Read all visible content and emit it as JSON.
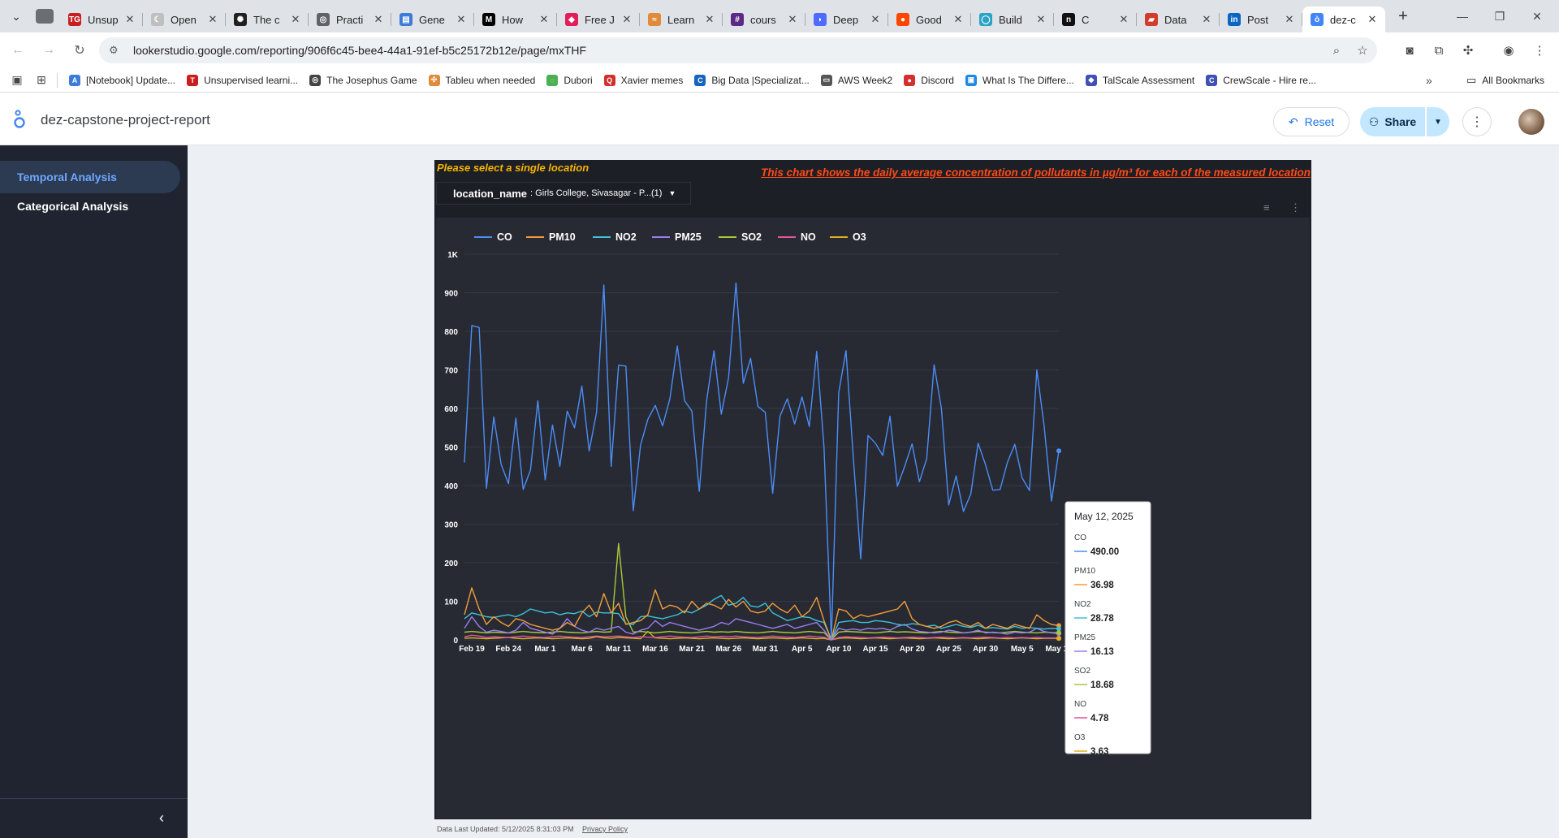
{
  "browser": {
    "tabs": [
      {
        "label": "Unsup",
        "icon": "tg-icon",
        "color": "#c81e1e",
        "glyph": "TG"
      },
      {
        "label": "Open",
        "icon": "crescent-icon",
        "color": "#bfbfbf",
        "glyph": "☾"
      },
      {
        "label": "The c",
        "icon": "aperture-icon",
        "color": "#202020",
        "glyph": "✺"
      },
      {
        "label": "Practi",
        "icon": "globe-icon",
        "color": "#5f6368",
        "glyph": "◎"
      },
      {
        "label": "Gene",
        "icon": "doc-icon",
        "color": "#3c7bd9",
        "glyph": "▤"
      },
      {
        "label": "How",
        "icon": "medium-icon",
        "color": "#000000",
        "glyph": "M"
      },
      {
        "label": "Free J",
        "icon": "cube-icon",
        "color": "#e11d5a",
        "glyph": "◆"
      },
      {
        "label": "Learn",
        "icon": "wave-icon",
        "color": "#e08a3c",
        "glyph": "≈"
      },
      {
        "label": "cours",
        "icon": "slack-icon",
        "color": "#5b2a86",
        "glyph": "#"
      },
      {
        "label": "Deep",
        "icon": "whale-icon",
        "color": "#4d6bfe",
        "glyph": "◗"
      },
      {
        "label": "Good",
        "icon": "reddit-icon",
        "color": "#ff4500",
        "glyph": "●"
      },
      {
        "label": "Build",
        "icon": "circle-icon",
        "color": "#29a3c7",
        "glyph": "◯"
      },
      {
        "label": "C",
        "icon": "notion-icon",
        "color": "#111111",
        "glyph": "n"
      },
      {
        "label": "Data",
        "icon": "paper-icon",
        "color": "#d43b2f",
        "glyph": "▰"
      },
      {
        "label": "Post",
        "icon": "linkedin-icon",
        "color": "#0a66c2",
        "glyph": "in"
      },
      {
        "label": "dez-c",
        "icon": "lookerstudio-icon",
        "color": "#4285f4",
        "glyph": "ò",
        "active": true
      }
    ],
    "url": "lookerstudio.google.com/reporting/906f6c45-bee4-44a1-91ef-b5c25172b12e/page/mxTHF",
    "bookmarks": [
      {
        "label": "[Notebook] Update...",
        "color": "#3c7bd9",
        "glyph": "A"
      },
      {
        "label": "Unsupervised learni...",
        "color": "#c81e1e",
        "glyph": "T"
      },
      {
        "label": "The Josephus Game",
        "color": "#444444",
        "glyph": "◎"
      },
      {
        "label": "Tableu when needed",
        "color": "#e08a3c",
        "glyph": "✣"
      },
      {
        "label": "Dubori",
        "color": "#4caf50",
        "glyph": "◌"
      },
      {
        "label": "Xavier memes",
        "color": "#d32f2f",
        "glyph": "Q"
      },
      {
        "label": "Big Data |Specializat...",
        "color": "#1565c0",
        "glyph": "C"
      },
      {
        "label": "AWS Week2",
        "color": "#555555",
        "glyph": "▭"
      },
      {
        "label": "Discord",
        "color": "#d32f2f",
        "glyph": "●"
      },
      {
        "label": "What Is The Differe...",
        "color": "#1e88e5",
        "glyph": "▣"
      },
      {
        "label": "TalScale Assessment",
        "color": "#3f51b5",
        "glyph": "◆"
      },
      {
        "label": "CrewScale - Hire re...",
        "color": "#3f51b5",
        "glyph": "C"
      }
    ],
    "all_bookmarks": "All Bookmarks",
    "more_bookmarks": "»"
  },
  "header": {
    "title": "dez-capstone-project-report",
    "reset_label": "Reset",
    "share_label": "Share"
  },
  "sidebar": {
    "items": [
      {
        "label": "Temporal Analysis",
        "active": true
      },
      {
        "label": "Categorical Analysis",
        "active": false
      }
    ]
  },
  "report": {
    "hint": "Please select a single location",
    "note": "This chart shows the daily average concentration of pollutants in µg/m³ for each of the measured location",
    "filter_name": "location_name",
    "filter_value": ": Girls College, Sivasagar - P...(1)",
    "footer_updated": "Data Last Updated: 5/12/2025 8:31:03 PM",
    "footer_privacy": "Privacy Policy"
  },
  "chart_data": {
    "type": "line",
    "x_start": "2025-02-18",
    "x_end": "2025-05-12",
    "x_ticks": [
      "Feb 19",
      "Feb 24",
      "Mar 1",
      "Mar 6",
      "Mar 11",
      "Mar 16",
      "Mar 21",
      "Mar 26",
      "Mar 31",
      "Apr 5",
      "Apr 10",
      "Apr 15",
      "Apr 20",
      "Apr 25",
      "Apr 30",
      "May 5",
      "May 10"
    ],
    "y_ticks": [
      "0",
      "100",
      "200",
      "300",
      "400",
      "500",
      "600",
      "700",
      "800",
      "900",
      "1K"
    ],
    "ylim": [
      0,
      1000
    ],
    "grid": true,
    "legend_position": "top-left",
    "series": [
      {
        "name": "CO",
        "color": "#4c8df6",
        "values": [
          460,
          815,
          810,
          393,
          578,
          455,
          405,
          575,
          390,
          440,
          620,
          415,
          557,
          450,
          593,
          550,
          658,
          490,
          590,
          920,
          450,
          712,
          710,
          335,
          505,
          572,
          608,
          555,
          625,
          762,
          620,
          593,
          385,
          620,
          750,
          585,
          680,
          925,
          665,
          730,
          605,
          590,
          380,
          580,
          625,
          560,
          630,
          553,
          748,
          500,
          0,
          640,
          750,
          470,
          210,
          530,
          510,
          478,
          580,
          398,
          450,
          508,
          410,
          470,
          713,
          600,
          350,
          425,
          333,
          378,
          510,
          455,
          388,
          390,
          460,
          507,
          420,
          387,
          700,
          555,
          360,
          490
        ]
      },
      {
        "name": "PM10",
        "color": "#f29d38",
        "values": [
          65,
          135,
          80,
          40,
          60,
          45,
          35,
          55,
          50,
          40,
          35,
          30,
          25,
          30,
          45,
          35,
          70,
          90,
          60,
          120,
          70,
          95,
          40,
          45,
          50,
          65,
          130,
          80,
          90,
          85,
          70,
          100,
          80,
          95,
          90,
          80,
          105,
          85,
          100,
          75,
          70,
          75,
          95,
          80,
          70,
          90,
          60,
          75,
          110,
          50,
          0,
          80,
          75,
          55,
          65,
          60,
          65,
          70,
          75,
          80,
          100,
          55,
          40,
          35,
          30,
          35,
          45,
          50,
          40,
          35,
          45,
          30,
          40,
          35,
          30,
          40,
          35,
          30,
          65,
          50,
          40,
          36.98
        ]
      },
      {
        "name": "NO2",
        "color": "#3cc3d9",
        "values": [
          55,
          70,
          65,
          60,
          58,
          62,
          65,
          60,
          68,
          80,
          75,
          70,
          72,
          65,
          70,
          68,
          75,
          60,
          72,
          70,
          70,
          68,
          42,
          40,
          60,
          62,
          58,
          55,
          60,
          65,
          75,
          70,
          80,
          90,
          105,
          115,
          90,
          95,
          110,
          88,
          85,
          95,
          70,
          60,
          50,
          55,
          60,
          58,
          50,
          45,
          0,
          45,
          48,
          50,
          45,
          45,
          50,
          48,
          45,
          40,
          38,
          42,
          40,
          35,
          38,
          30,
          35,
          40,
          35,
          32,
          38,
          30,
          32,
          30,
          28,
          35,
          30,
          32,
          30,
          28,
          30,
          28.78
        ]
      },
      {
        "name": "PM25",
        "color": "#9b7df0",
        "values": [
          30,
          60,
          35,
          20,
          25,
          22,
          18,
          25,
          45,
          30,
          25,
          20,
          15,
          30,
          55,
          35,
          25,
          20,
          30,
          25,
          30,
          35,
          20,
          15,
          25,
          30,
          50,
          35,
          45,
          40,
          35,
          30,
          25,
          30,
          35,
          45,
          40,
          55,
          50,
          45,
          40,
          35,
          30,
          35,
          40,
          30,
          35,
          40,
          45,
          25,
          0,
          30,
          25,
          28,
          25,
          30,
          28,
          30,
          25,
          35,
          40,
          28,
          22,
          20,
          18,
          20,
          25,
          22,
          18,
          20,
          25,
          18,
          20,
          18,
          15,
          20,
          18,
          20,
          30,
          22,
          18,
          16.13
        ]
      },
      {
        "name": "SO2",
        "color": "#a7c93a",
        "values": [
          20,
          22,
          20,
          18,
          20,
          19,
          18,
          20,
          22,
          20,
          19,
          18,
          20,
          22,
          20,
          19,
          18,
          20,
          22,
          20,
          21,
          250,
          60,
          20,
          22,
          20,
          18,
          20,
          22,
          20,
          19,
          18,
          20,
          22,
          20,
          21,
          20,
          22,
          20,
          19,
          18,
          20,
          22,
          20,
          19,
          18,
          20,
          22,
          20,
          19,
          0,
          20,
          22,
          21,
          20,
          19,
          18,
          20,
          22,
          20,
          21,
          20,
          19,
          18,
          20,
          22,
          20,
          19,
          18,
          20,
          22,
          20,
          19,
          18,
          20,
          22,
          20,
          19,
          18,
          20,
          19,
          18.68
        ]
      },
      {
        "name": "NO",
        "color": "#e056a0",
        "values": [
          8,
          12,
          10,
          6,
          8,
          7,
          6,
          8,
          10,
          8,
          7,
          6,
          8,
          10,
          8,
          7,
          6,
          8,
          10,
          8,
          9,
          10,
          8,
          6,
          8,
          7,
          6,
          8,
          10,
          8,
          7,
          6,
          8,
          10,
          8,
          9,
          8,
          10,
          8,
          7,
          6,
          8,
          10,
          8,
          7,
          6,
          8,
          10,
          8,
          7,
          0,
          6,
          8,
          7,
          6,
          5,
          6,
          7,
          6,
          5,
          6,
          7,
          6,
          5,
          6,
          7,
          6,
          5,
          6,
          5,
          6,
          7,
          6,
          5,
          6,
          5,
          6,
          5,
          6,
          5,
          5,
          4.78
        ]
      },
      {
        "name": "O3",
        "color": "#e0b11f",
        "values": [
          4,
          5,
          4,
          3,
          4,
          5,
          6,
          4,
          3,
          4,
          5,
          4,
          3,
          4,
          5,
          4,
          3,
          4,
          8,
          5,
          4,
          6,
          5,
          4,
          3,
          22,
          5,
          4,
          3,
          4,
          5,
          4,
          3,
          4,
          5,
          4,
          3,
          4,
          5,
          4,
          3,
          4,
          5,
          4,
          3,
          4,
          5,
          4,
          3,
          4,
          0,
          4,
          5,
          4,
          3,
          4,
          5,
          4,
          3,
          4,
          5,
          4,
          3,
          4,
          5,
          4,
          3,
          4,
          5,
          4,
          3,
          4,
          5,
          4,
          3,
          4,
          5,
          4,
          3,
          4,
          4,
          3.63
        ]
      }
    ],
    "tooltip": {
      "date": "May 12, 2025",
      "series_index": 81
    }
  }
}
